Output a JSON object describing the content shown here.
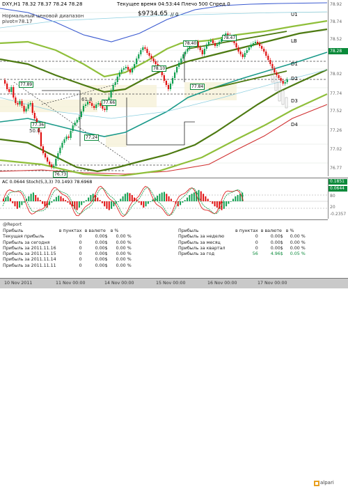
{
  "header": {
    "symbol_line": "DXY,H1  78.32 78.37 78.24 78.28",
    "pivot_caption": "Нормальный ценовой диапазон",
    "pivot_value": "pivot=78.17",
    "server_time": "Текущее время 04:53:44 Плечо 500 Спред 0",
    "balance": "$9734.65",
    "balance_suffix": "// 0"
  },
  "levels": {
    "U1": "U1",
    "LB": "LB",
    "D1": "D1",
    "D2": "D2",
    "D3": "D3",
    "D4": "D4"
  },
  "chart_labels": {
    "p77_89": "77.89",
    "p77_36": "77.36",
    "p50_0": "50.0",
    "p61_8": "61.8",
    "p77_66": "77.66",
    "p77_24": "77.24",
    "p76_73": "76.73",
    "p78_10": "78.10",
    "p78_40": "78.40",
    "p77_84": "77.84",
    "p78_47": "78.47"
  },
  "price_axis": {
    "ticks": [
      "78.92",
      "78.74",
      "78.52",
      "78.28",
      "78.02",
      "77.74",
      "77.52",
      "77.26",
      "77.02",
      "76.77"
    ],
    "current": "78.28"
  },
  "indicator": {
    "title": "AC 0.0644  Stoch(5,3,3) 70.1493 78.6968",
    "ticks": [
      "0.1851",
      "80",
      "20",
      "-0.2357"
    ],
    "box_value": "0.0644"
  },
  "report": {
    "title": "@Report",
    "left_header": [
      "Прибыль",
      "в пунктах",
      "в валюте",
      "в %"
    ],
    "left_rows": [
      [
        "Текущая прибыль",
        "0",
        "0.00$",
        "0.00 %"
      ],
      [
        "Прибыль за сегодня",
        "0",
        "0.00$",
        "0.00 %"
      ],
      [
        "Прибыль за 2011.11.16",
        "0",
        "0.00$",
        "0.00 %"
      ],
      [
        "Прибыль за 2011.11.15",
        "0",
        "0.00$",
        "0.00 %"
      ],
      [
        "Прибыль за 2011.11.14",
        "0",
        "0.00$",
        "0.00 %"
      ],
      [
        "Прибыль за 2011.11.11",
        "0",
        "0.00$",
        "0.00 %"
      ]
    ],
    "right_header": [
      "Прибыль",
      "в пунктах",
      "в валюте",
      "в %"
    ],
    "right_rows": [
      [
        "Прибыль за неделю",
        "0",
        "0.00$",
        "0.00 %"
      ],
      [
        "Прибыль за месяц",
        "0",
        "0.00$",
        "0.00 %"
      ],
      [
        "Прибыль за квартал",
        "0",
        "0.00$",
        "0.00 %"
      ],
      [
        "Прибыль за год",
        "56",
        "4.96$",
        "0.05 %"
      ]
    ],
    "logo_text": "alpari"
  },
  "time_axis": [
    "10 Nov 2011",
    "11 Nov 00:00",
    "14 Nov 00:00",
    "15 Nov 00:00",
    "16 Nov 00:00",
    "17 Nov 00:00"
  ],
  "colors": {
    "band_dark": "#4d7a12",
    "band_light": "#8fbf3a",
    "ma_teal": "#1a9a8a",
    "candle_green": "#10a050",
    "candle_red": "#e01010",
    "bull": "#0a8a3a"
  }
}
